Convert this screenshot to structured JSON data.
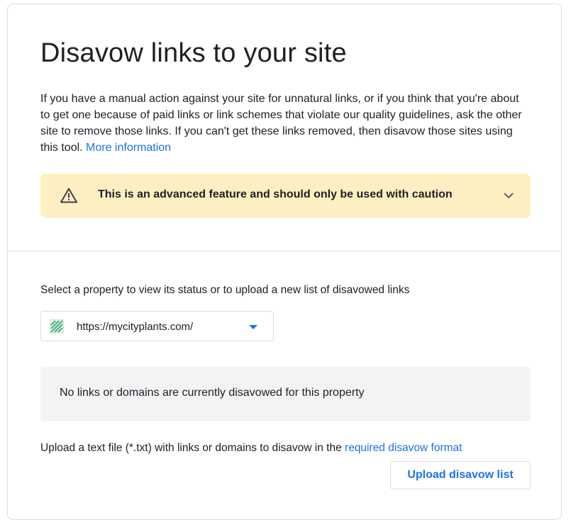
{
  "header": {
    "title": "Disavow links to your site"
  },
  "description": {
    "text": "If you have a manual action against your site for unnatural links, or if you think that you're about to get one because of paid links or link schemes that violate our quality guidelines, ask the other site to remove those links. If you can't get these links removed, then disavow those sites using this tool. ",
    "more_info_link": "More information"
  },
  "warning": {
    "text": "This is an advanced feature and should only be used with caution",
    "icon": "warning-triangle-icon",
    "expand_icon": "chevron-down-icon"
  },
  "property": {
    "label": "Select a property to view its status or to upload a new list of disavowed links",
    "selected": "https://mycityplants.com/"
  },
  "status": {
    "text": "No links or domains are currently disavowed for this property"
  },
  "upload": {
    "info_text": "Upload a text file (*.txt) with links or domains to disavow in the ",
    "format_link": "required disavow format",
    "button_label": "Upload disavow list"
  },
  "colors": {
    "accent": "#1a73e8",
    "warning_bg": "#feefc3",
    "status_bg": "#f1f3f4",
    "border": "#dadce0"
  }
}
